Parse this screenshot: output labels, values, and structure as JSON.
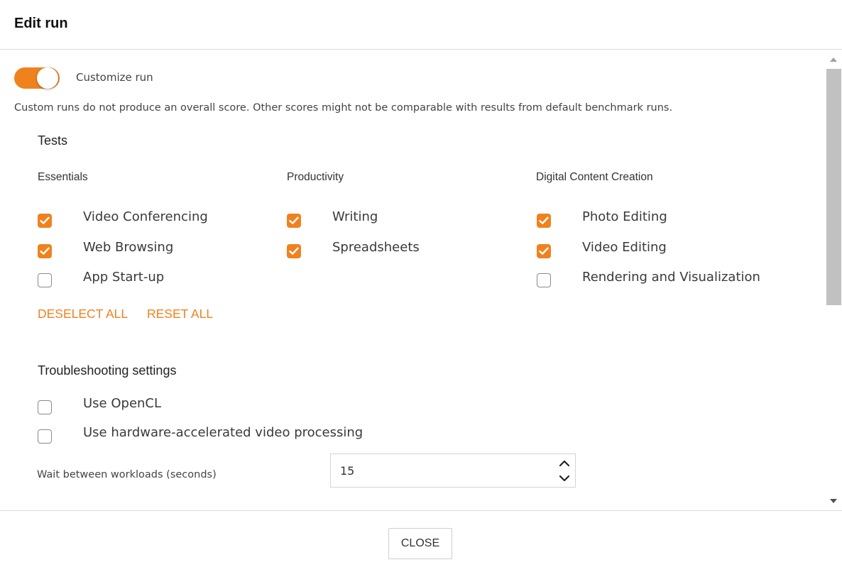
{
  "dialog": {
    "title": "Edit run",
    "close_label": "CLOSE"
  },
  "customize": {
    "label": "Customize run",
    "enabled": true,
    "note": "Custom runs do not produce an overall score. Other scores might not be comparable with results from default benchmark runs."
  },
  "tests": {
    "heading": "Tests",
    "columns": [
      {
        "heading": "Essentials",
        "items": [
          {
            "label": "Video Conferencing",
            "checked": true
          },
          {
            "label": "Web Browsing",
            "checked": true
          },
          {
            "label": "App Start-up",
            "checked": false
          }
        ]
      },
      {
        "heading": "Productivity",
        "items": [
          {
            "label": "Writing",
            "checked": true
          },
          {
            "label": "Spreadsheets",
            "checked": true
          }
        ]
      },
      {
        "heading": "Digital Content Creation",
        "items": [
          {
            "label": "Photo Editing",
            "checked": true
          },
          {
            "label": "Video Editing",
            "checked": true
          },
          {
            "label": "Rendering and Visualization",
            "checked": false
          }
        ]
      }
    ],
    "deselect_all_label": "DESELECT ALL",
    "reset_all_label": "RESET ALL"
  },
  "troubleshooting": {
    "heading": "Troubleshooting settings",
    "items": [
      {
        "label": "Use OpenCL",
        "checked": false
      },
      {
        "label": "Use hardware-accelerated video processing",
        "checked": false
      }
    ],
    "wait_label": "Wait between workloads (seconds)",
    "wait_value": "15"
  },
  "colors": {
    "accent": "#f0821e",
    "border": "#dcdcdc",
    "scroll_thumb": "#c1c1c1"
  }
}
